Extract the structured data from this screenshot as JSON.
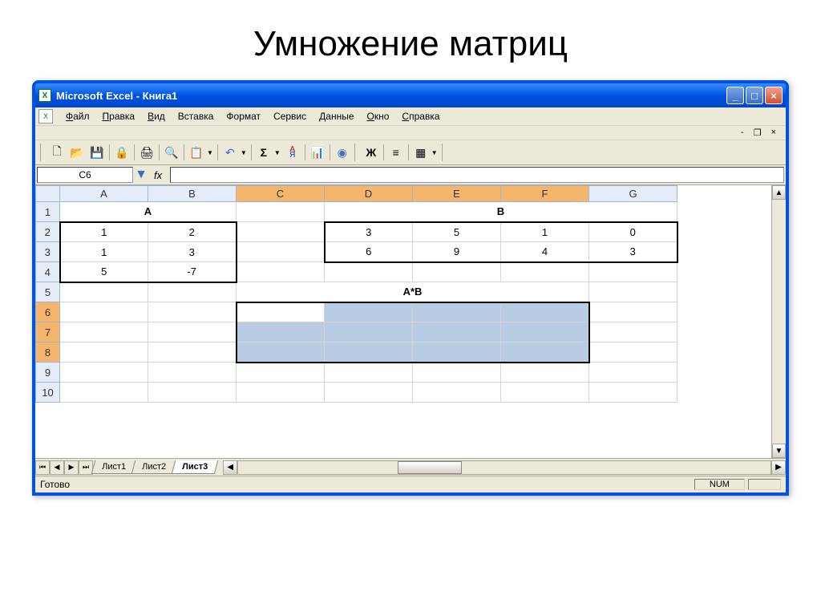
{
  "slide_title": "Умножение матриц",
  "titlebar": {
    "text": "Microsoft Excel - Книга1"
  },
  "menu": {
    "items": [
      "Файл",
      "Правка",
      "Вид",
      "Вставка",
      "Формат",
      "Сервис",
      "Данные",
      "Окно",
      "Справка"
    ],
    "underline_idx": [
      0,
      0,
      0,
      -1,
      -1,
      -1,
      0,
      0,
      0
    ]
  },
  "toolbar": {
    "bold_label": "Ж"
  },
  "formula_bar": {
    "name_box": "C6",
    "fx": "fx",
    "formula": ""
  },
  "columns": [
    "A",
    "B",
    "C",
    "D",
    "E",
    "F",
    "G"
  ],
  "selected_cols": [
    "C",
    "D",
    "E",
    "F"
  ],
  "selected_rows": [
    6,
    7,
    8
  ],
  "rows": [
    1,
    2,
    3,
    4,
    5,
    6,
    7,
    8,
    9,
    10
  ],
  "cells": {
    "header_A": "A",
    "header_B": "B",
    "header_AB": "A*B",
    "matA": [
      [
        "1",
        "2"
      ],
      [
        "1",
        "3"
      ],
      [
        "5",
        "-7"
      ]
    ],
    "matB": [
      [
        "3",
        "5",
        "1",
        "0"
      ],
      [
        "6",
        "9",
        "4",
        "3"
      ]
    ]
  },
  "tabs": {
    "sheets": [
      "Лист1",
      "Лист2",
      "Лист3"
    ],
    "active": 2
  },
  "statusbar": {
    "ready": "Готово",
    "num": "NUM"
  }
}
